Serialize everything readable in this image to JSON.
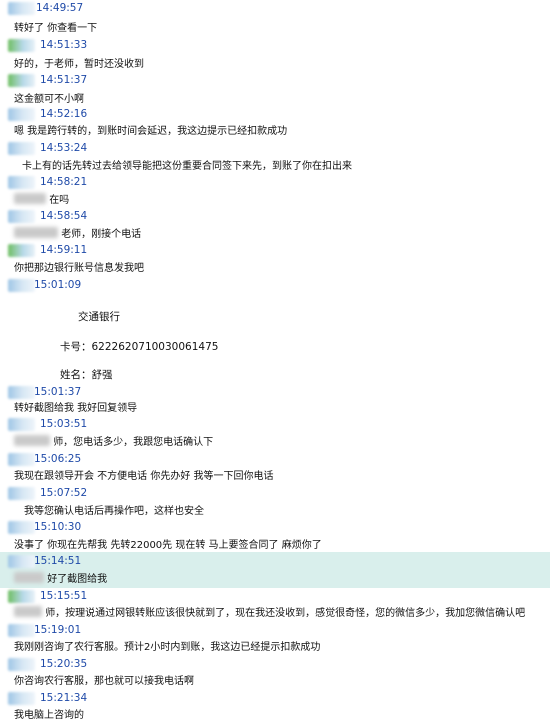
{
  "messages": [
    {
      "time": "14:49:57",
      "text": "转好了 你查看一下"
    },
    {
      "time": "14:51:33",
      "text": "好的，于老师，暂时还没收到"
    },
    {
      "time": "14:51:37",
      "text": "这金额可不小啊"
    },
    {
      "time": "14:52:16",
      "text": "嗯 我是跨行转的，到账时间会延迟，我这边提示已经扣款成功"
    },
    {
      "time": "14:53:24",
      "text": "卡上有的话先转过去给领导能把这份重要合同签下来先，到账了你在扣出来"
    },
    {
      "time": "14:58:21",
      "text": "在吗"
    },
    {
      "time": "14:58:54",
      "text": "老师，刚接个电话"
    },
    {
      "time": "14:59:11",
      "text": "你把那边银行账号信息发我吧"
    },
    {
      "time": "15:01:09",
      "text": ""
    },
    {
      "time": "15:01:37",
      "text": "转好截图给我 我好回复领导"
    },
    {
      "time": "15:03:51",
      "text": "师，您电话多少，我跟您电话确认下"
    },
    {
      "time": "15:06:25",
      "text": "我现在跟领导开会 不方便电话 你先办好 我等一下回你电话"
    },
    {
      "time": "15:07:52",
      "text": "我等您确认电话后再操作吧，这样也安全"
    },
    {
      "time": "15:10:30",
      "text": "没事了 你现在先帮我 先转22000先 现在转 马上要签合同了 麻烦你了"
    },
    {
      "time": "15:14:51",
      "text": "好了截图给我"
    },
    {
      "time": "15:15:51",
      "text": "师，按理说通过网银转账应该很快就到了，现在我还没收到，感觉很奇怪，您的微信多少，我加您微信确认吧"
    },
    {
      "time": "15:19:01",
      "text": "我刚刚咨询了农行客服。预计2小时内到账，我这边已经提示扣款成功"
    },
    {
      "time": "15:20:35",
      "text": "你咨询农行客服，那也就可以接我电话啊"
    },
    {
      "time": "15:21:34",
      "text": "我电脑上咨询的"
    }
  ],
  "bank_info": {
    "bank": "交通银行",
    "card": "卡号：6222620710030061475",
    "name": "姓名：舒强"
  }
}
